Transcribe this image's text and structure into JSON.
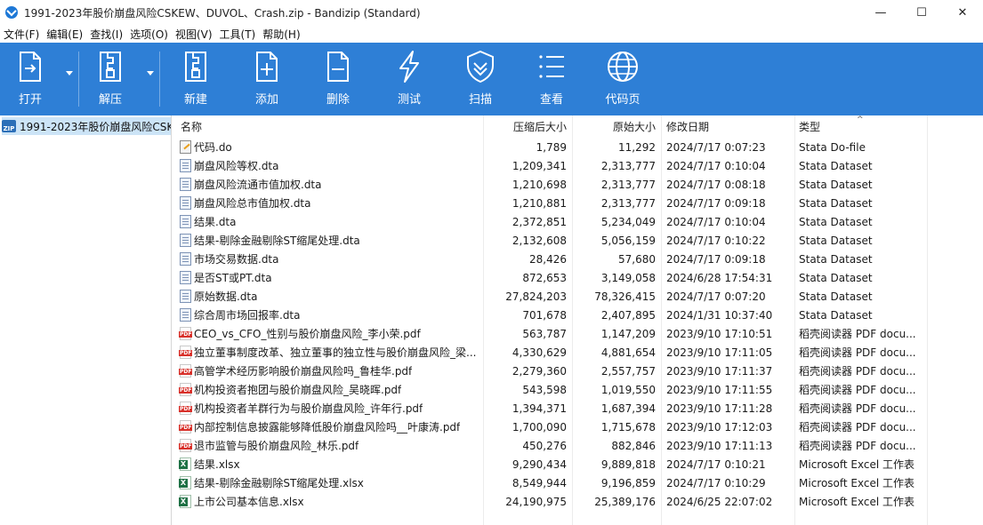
{
  "window": {
    "title": "1991-2023年股价崩盘风险CSKEW、DUVOL、Crash.zip - Bandizip (Standard)",
    "minimize": "—",
    "maximize": "☐",
    "close": "✕"
  },
  "menu": [
    "文件(F)",
    "编辑(E)",
    "查找(I)",
    "选项(O)",
    "视图(V)",
    "工具(T)",
    "帮助(H)"
  ],
  "toolbar": {
    "open": "打开",
    "extract": "解压",
    "new": "新建",
    "add": "添加",
    "delete": "删除",
    "test": "测试",
    "scan": "扫描",
    "view": "查看",
    "codepage": "代码页"
  },
  "tree": {
    "root": "1991-2023年股价崩盘风险CSK"
  },
  "columns": {
    "name": "名称",
    "compressed": "压缩后大小",
    "original": "原始大小",
    "modified": "修改日期",
    "type": "类型"
  },
  "files": [
    {
      "icon": "do",
      "name": "代码.do",
      "compressed": "1,789",
      "original": "11,292",
      "modified": "2024/7/17 0:07:23",
      "type": "Stata Do-file"
    },
    {
      "icon": "dta",
      "name": "崩盘风险等权.dta",
      "compressed": "1,209,341",
      "original": "2,313,777",
      "modified": "2024/7/17 0:10:04",
      "type": "Stata Dataset"
    },
    {
      "icon": "dta",
      "name": "崩盘风险流通市值加权.dta",
      "compressed": "1,210,698",
      "original": "2,313,777",
      "modified": "2024/7/17 0:08:18",
      "type": "Stata Dataset"
    },
    {
      "icon": "dta",
      "name": "崩盘风险总市值加权.dta",
      "compressed": "1,210,881",
      "original": "2,313,777",
      "modified": "2024/7/17 0:09:18",
      "type": "Stata Dataset"
    },
    {
      "icon": "dta",
      "name": "结果.dta",
      "compressed": "2,372,851",
      "original": "5,234,049",
      "modified": "2024/7/17 0:10:04",
      "type": "Stata Dataset"
    },
    {
      "icon": "dta",
      "name": "结果-剔除金融剔除ST缩尾处理.dta",
      "compressed": "2,132,608",
      "original": "5,056,159",
      "modified": "2024/7/17 0:10:22",
      "type": "Stata Dataset"
    },
    {
      "icon": "dta",
      "name": "市场交易数据.dta",
      "compressed": "28,426",
      "original": "57,680",
      "modified": "2024/7/17 0:09:18",
      "type": "Stata Dataset"
    },
    {
      "icon": "dta",
      "name": "是否ST或PT.dta",
      "compressed": "872,653",
      "original": "3,149,058",
      "modified": "2024/6/28 17:54:31",
      "type": "Stata Dataset"
    },
    {
      "icon": "dta",
      "name": "原始数据.dta",
      "compressed": "27,824,203",
      "original": "78,326,415",
      "modified": "2024/7/17 0:07:20",
      "type": "Stata Dataset"
    },
    {
      "icon": "dta",
      "name": "综合周市场回报率.dta",
      "compressed": "701,678",
      "original": "2,407,895",
      "modified": "2024/1/31 10:37:40",
      "type": "Stata Dataset"
    },
    {
      "icon": "pdf",
      "name": "CEO_vs_CFO_性别与股价崩盘风险_李小荣.pdf",
      "compressed": "563,787",
      "original": "1,147,209",
      "modified": "2023/9/10 17:10:51",
      "type": "稻壳阅读器 PDF docu..."
    },
    {
      "icon": "pdf",
      "name": "独立董事制度改革、独立董事的独立性与股价崩盘风险_梁...",
      "compressed": "4,330,629",
      "original": "4,881,654",
      "modified": "2023/9/10 17:11:05",
      "type": "稻壳阅读器 PDF docu..."
    },
    {
      "icon": "pdf",
      "name": "高管学术经历影响股价崩盘风险吗_鲁桂华.pdf",
      "compressed": "2,279,360",
      "original": "2,557,757",
      "modified": "2023/9/10 17:11:37",
      "type": "稻壳阅读器 PDF docu..."
    },
    {
      "icon": "pdf",
      "name": "机构投资者抱团与股价崩盘风险_吴晓晖.pdf",
      "compressed": "543,598",
      "original": "1,019,550",
      "modified": "2023/9/10 17:11:55",
      "type": "稻壳阅读器 PDF docu..."
    },
    {
      "icon": "pdf",
      "name": "机构投资者羊群行为与股价崩盘风险_许年行.pdf",
      "compressed": "1,394,371",
      "original": "1,687,394",
      "modified": "2023/9/10 17:11:28",
      "type": "稻壳阅读器 PDF docu..."
    },
    {
      "icon": "pdf",
      "name": "内部控制信息披露能够降低股价崩盘风险吗__叶康涛.pdf",
      "compressed": "1,700,090",
      "original": "1,715,678",
      "modified": "2023/9/10 17:12:03",
      "type": "稻壳阅读器 PDF docu..."
    },
    {
      "icon": "pdf",
      "name": "退市监管与股价崩盘风险_林乐.pdf",
      "compressed": "450,276",
      "original": "882,846",
      "modified": "2023/9/10 17:11:13",
      "type": "稻壳阅读器 PDF docu..."
    },
    {
      "icon": "xlsx",
      "name": "结果.xlsx",
      "compressed": "9,290,434",
      "original": "9,889,818",
      "modified": "2024/7/17 0:10:21",
      "type": "Microsoft Excel 工作表"
    },
    {
      "icon": "xlsx",
      "name": "结果-剔除金融剔除ST缩尾处理.xlsx",
      "compressed": "8,549,944",
      "original": "9,196,859",
      "modified": "2024/7/17 0:10:29",
      "type": "Microsoft Excel 工作表"
    },
    {
      "icon": "xlsx",
      "name": "上市公司基本信息.xlsx",
      "compressed": "24,190,975",
      "original": "25,389,176",
      "modified": "2024/6/25 22:07:02",
      "type": "Microsoft Excel 工作表"
    }
  ],
  "colors": {
    "toolbar": "#2e7fd6",
    "selection": "#cce4f7"
  }
}
